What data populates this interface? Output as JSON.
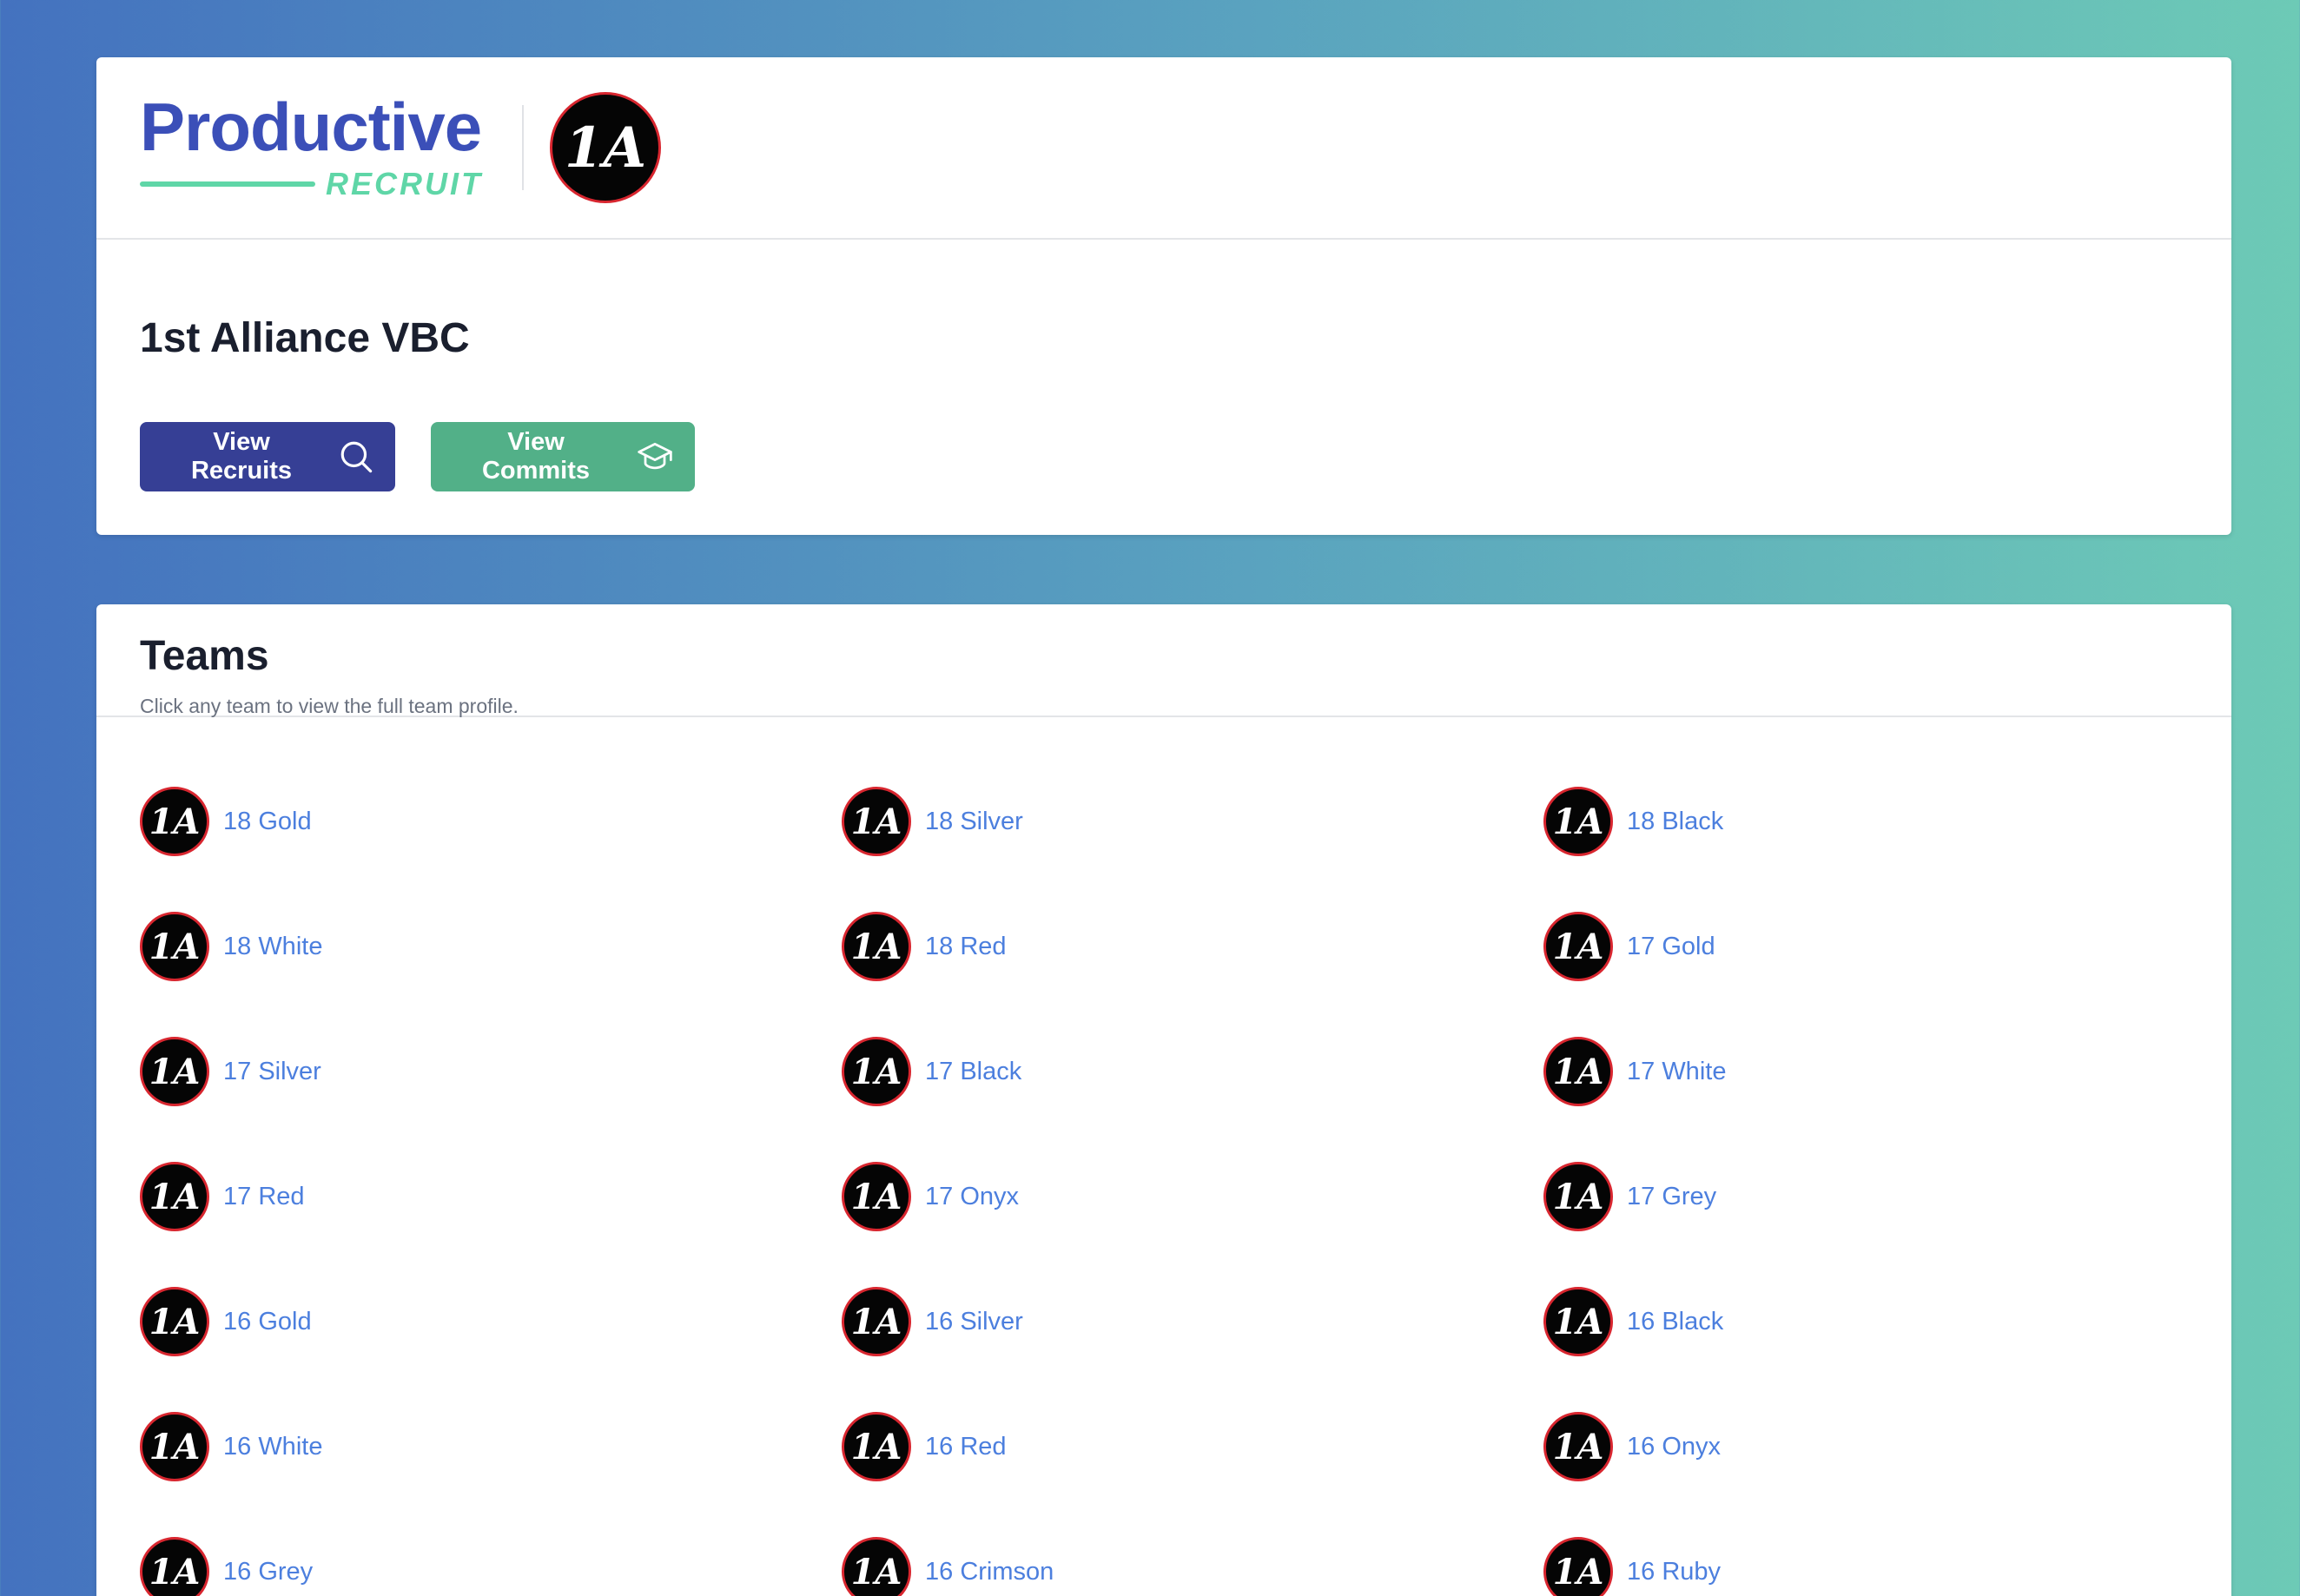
{
  "brand": {
    "name": "Productive",
    "sub": "RECRUIT"
  },
  "club": {
    "logo_text": "1A",
    "name": "1st Alliance VBC"
  },
  "actions": {
    "recruits_label": "View Recruits",
    "commits_label": "View Commits"
  },
  "teams": {
    "title": "Teams",
    "subtitle": "Click any team to view the full team profile.",
    "items": [
      "18 Gold",
      "18 Silver",
      "18 Black",
      "18 White",
      "18 Red",
      "17 Gold",
      "17 Silver",
      "17 Black",
      "17 White",
      "17 Red",
      "17 Onyx",
      "17 Grey",
      "16 Gold",
      "16 Silver",
      "16 Black",
      "16 White",
      "16 Red",
      "16 Onyx",
      "16 Grey",
      "16 Crimson",
      "16 Ruby"
    ]
  },
  "colors": {
    "brand_blue": "#3b4fb8",
    "brand_green": "#5fd6a7",
    "recruits_button": "#363f95",
    "commits_button": "#52b088",
    "team_link": "#4c7fde",
    "logo_ring": "#d8262f"
  }
}
